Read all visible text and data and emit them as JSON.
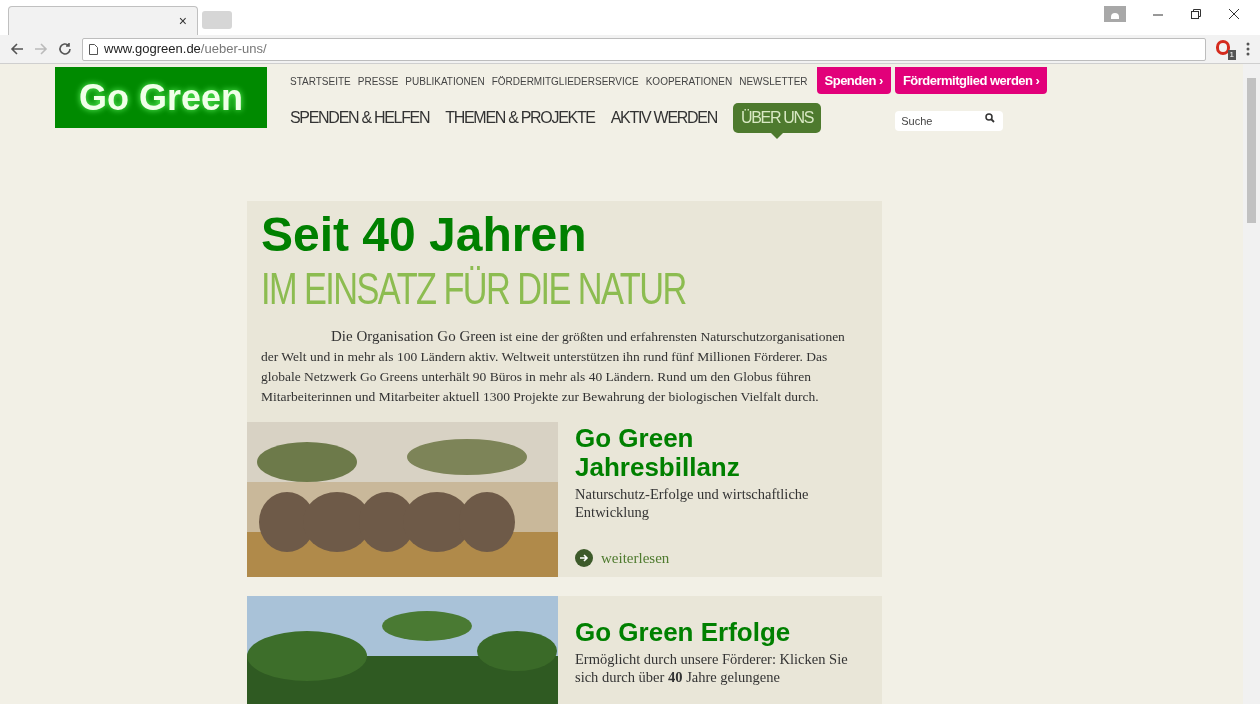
{
  "browser": {
    "tabs": [
      {
        "selected": true
      },
      {
        "selected": false
      }
    ],
    "tab_close": "×",
    "url_domain": "www.gogreen.de",
    "url_path": "/ueber-uns/",
    "extension_badge": "1"
  },
  "site": {
    "logo": "Go Green",
    "top_nav": [
      "STARTSEITE",
      "PRESSE",
      "PUBLIKATIONEN",
      "FÖRDERMITGLIEDERSERVICE",
      "KOOPERATIONEN",
      "NEWSLETTER"
    ],
    "cta_buttons": [
      "Spenden ›",
      "Fördermitglied werden ›"
    ],
    "main_nav": [
      {
        "label": "SPENDEN & HELFEN",
        "selected": false
      },
      {
        "label": "THEMEN & PROJEKTE",
        "selected": false
      },
      {
        "label": "AKTIV WERDEN",
        "selected": false
      },
      {
        "label": "ÜBER UNS",
        "selected": true
      }
    ],
    "search": {
      "placeholder": "Suche"
    }
  },
  "hero": {
    "title": "Seit 40 Jahren",
    "subtitle": "IM EINSATZ FÜR DIE NATUR",
    "intro_lead": "Die Organisation Go Green",
    "intro_text": " ist eine der größten und erfahrensten Naturschutzorganisationen der Welt und in mehr als 100 Ländern aktiv. Weltweit unterstützen ihn rund fünf Millionen Förderer. Das globale Netzwerk Go Greens unterhält 90 Büros in mehr als 40 Ländern. Rund um den Globus führen Mitarbeiterinnen und Mitarbeiter aktuell 1300 Projekte zur Bewahrung der biologischen Vielfalt durch."
  },
  "teasers": [
    {
      "kind": "elephants",
      "title": "Go Green Jahresbillanz",
      "text": "Naturschutz-Erfolge und wirtschaftliche Entwicklung",
      "link": "weiterlesen"
    },
    {
      "kind": "forest",
      "title": "Go Green Erfolge",
      "text": "Ermöglicht durch unsere Förderer: Klicken Sie sich durch über **40** Jahre gelungene"
    }
  ]
}
